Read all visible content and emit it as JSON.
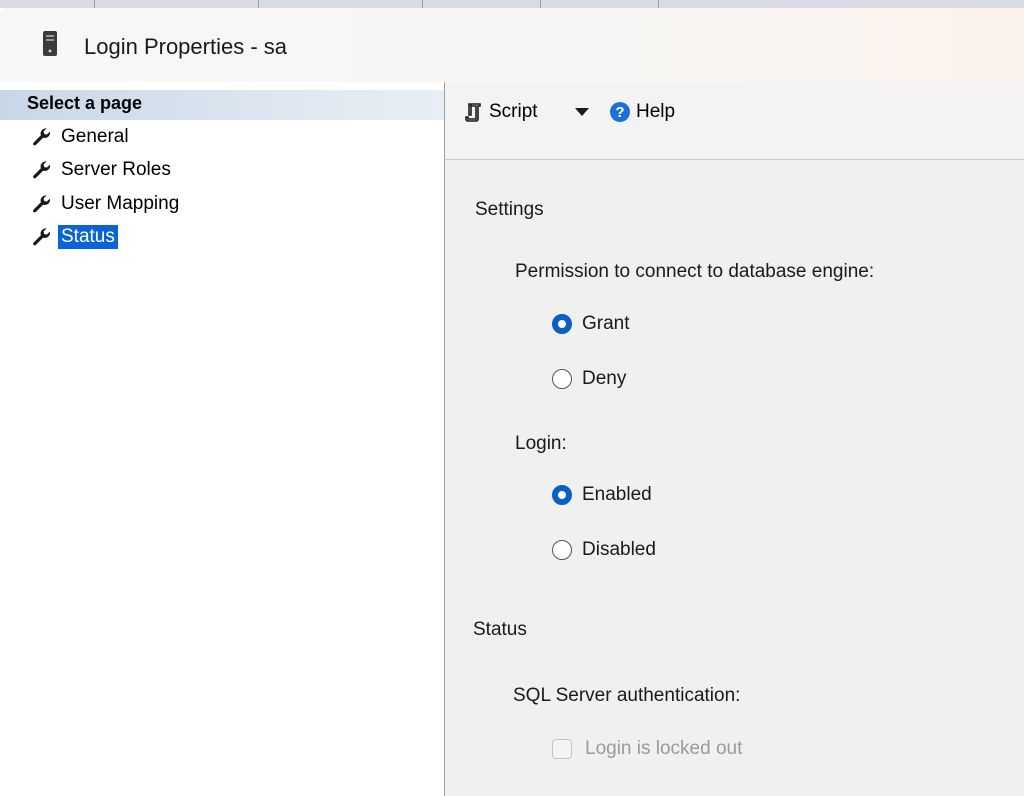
{
  "window": {
    "title": "Login Properties - sa",
    "icon": "server-icon"
  },
  "left_pane": {
    "header": "Select a page",
    "items": [
      {
        "label": "General",
        "icon": "wrench-icon",
        "selected": false
      },
      {
        "label": "Server Roles",
        "icon": "wrench-icon",
        "selected": false
      },
      {
        "label": "User Mapping",
        "icon": "wrench-icon",
        "selected": false
      },
      {
        "label": "Status",
        "icon": "wrench-icon",
        "selected": true
      }
    ],
    "selected_color": "#0a64d8"
  },
  "toolbar": {
    "script_label": "Script",
    "help_label": "Help",
    "help_icon_glyph": "?"
  },
  "settings": {
    "title": "Settings",
    "permission_label": "Permission to connect to database engine:",
    "permission_options": [
      {
        "label": "Grant",
        "checked": true
      },
      {
        "label": "Deny",
        "checked": false
      }
    ],
    "login_label": "Login:",
    "login_options": [
      {
        "label": "Enabled",
        "checked": true
      },
      {
        "label": "Disabled",
        "checked": false
      }
    ]
  },
  "status": {
    "title": "Status",
    "auth_label": "SQL Server authentication:",
    "locked_out_label": "Login is locked out",
    "locked_out_checked": false,
    "locked_out_enabled": false
  },
  "colors": {
    "accent": "#0a5fc4",
    "pane_background": "#f0f0f0",
    "header_gradient_start": "#c8d7e8"
  }
}
